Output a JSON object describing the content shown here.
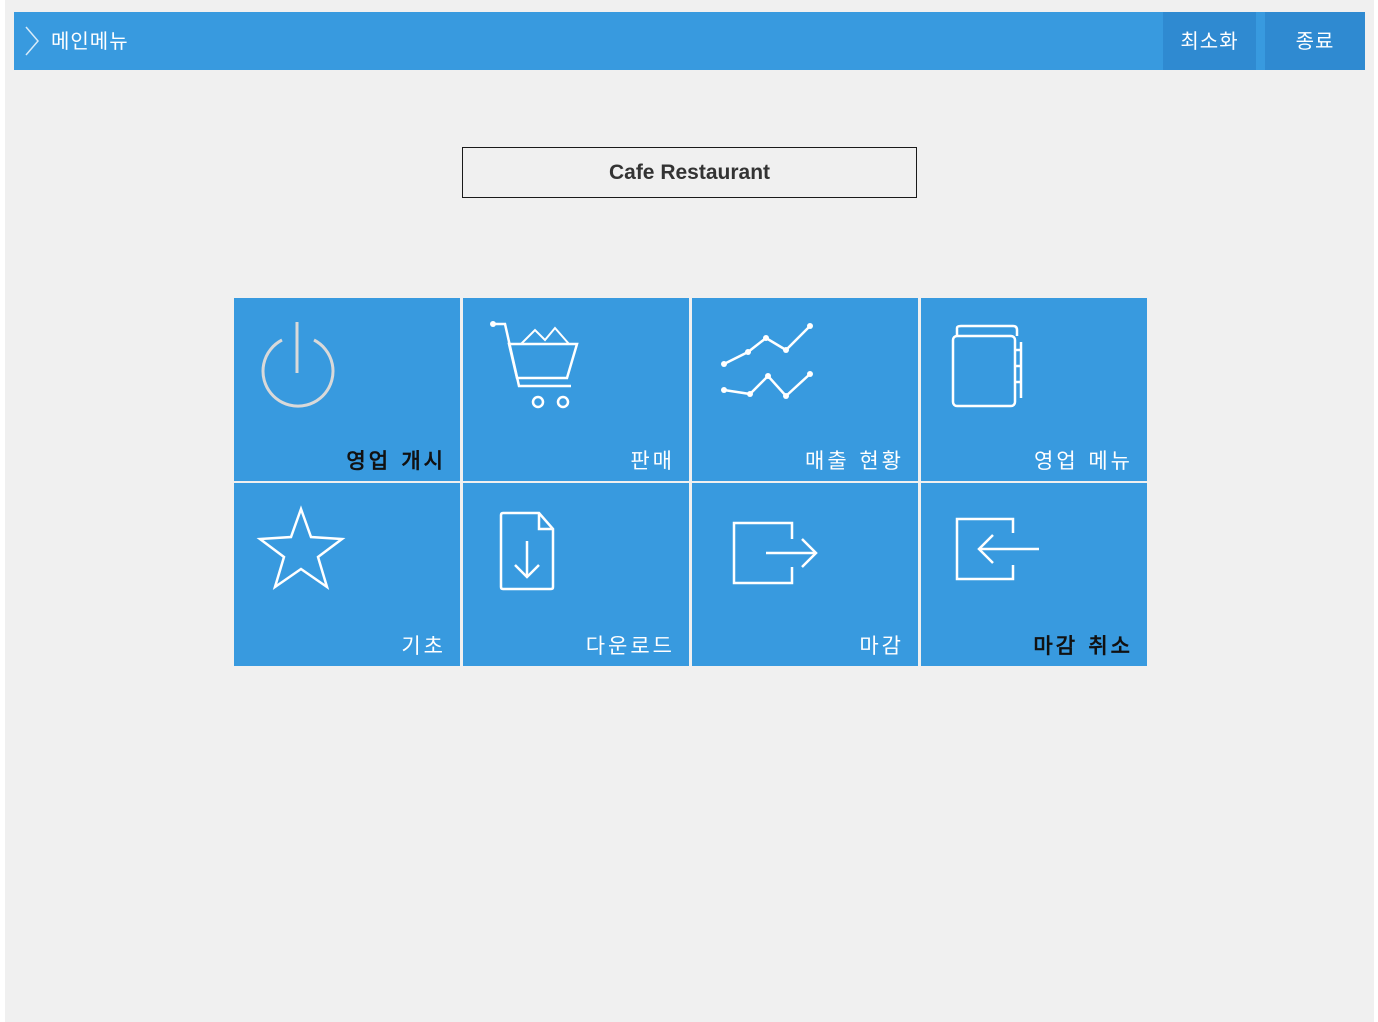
{
  "window": {
    "title": "메인메뉴",
    "buttons": {
      "minimize": "최소화",
      "exit": "종료"
    }
  },
  "store": {
    "name": "Cafe Restaurant"
  },
  "menu": {
    "tiles": [
      {
        "label": "영업 개시",
        "icon": "power-icon",
        "label_style": "dark"
      },
      {
        "label": "판매",
        "icon": "shopping-cart-icon",
        "label_style": "light"
      },
      {
        "label": "매출 현황",
        "icon": "line-chart-icon",
        "label_style": "light"
      },
      {
        "label": "영업 메뉴",
        "icon": "book-icon",
        "label_style": "light"
      },
      {
        "label": "기초",
        "icon": "star-icon",
        "label_style": "light"
      },
      {
        "label": "다운로드",
        "icon": "download-file-icon",
        "label_style": "light"
      },
      {
        "label": "마감",
        "icon": "sign-out-icon",
        "label_style": "light"
      },
      {
        "label": "마감 취소",
        "icon": "sign-in-icon",
        "label_style": "dark"
      }
    ]
  },
  "colors": {
    "accent": "#389adf",
    "titlebar_button": "#2f8ad1",
    "background": "#f0f0f0"
  }
}
